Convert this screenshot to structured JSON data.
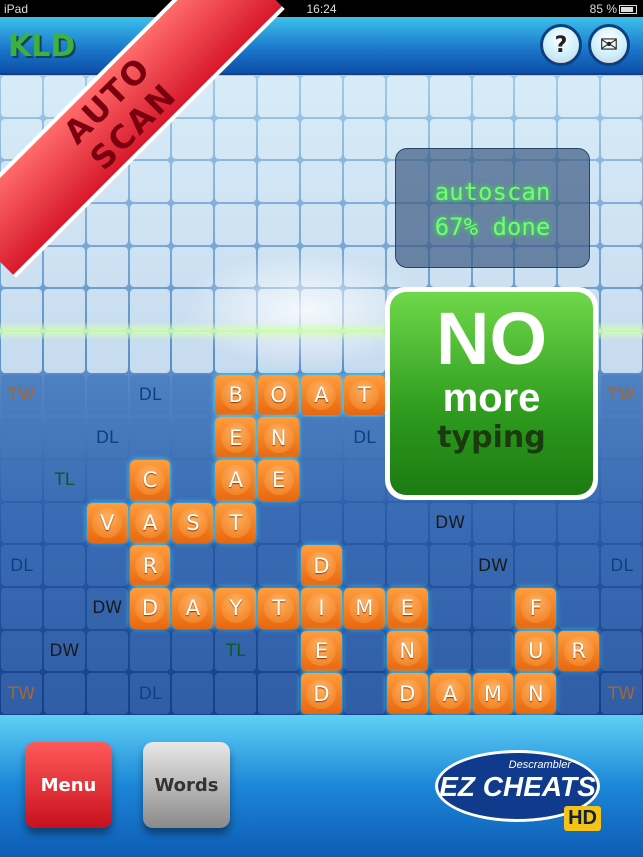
{
  "status_bar": {
    "device": "iPad",
    "time": "16:24",
    "battery": "85 %"
  },
  "header": {
    "logo": "KLD",
    "help_label": "?",
    "mail_icon": "envelope-icon"
  },
  "ribbon": {
    "line1": "AUTO",
    "line2": "SCAN"
  },
  "autoscan": {
    "line1": "autoscan",
    "line2": "67% done",
    "progress_percent": 67
  },
  "promo": {
    "line1": "NO",
    "line2": "more",
    "line3": "typing"
  },
  "board": {
    "size": 15,
    "visible_rows_start": 7,
    "rows": [
      [
        "TW",
        "",
        "",
        "DL",
        "",
        "B",
        "O",
        "A",
        "T",
        "",
        "",
        "",
        "",
        "",
        "TW"
      ],
      [
        "",
        "",
        "DL",
        "",
        "",
        "E",
        "N",
        "",
        "DL",
        "",
        "",
        "",
        "",
        "",
        ""
      ],
      [
        "",
        "TL",
        "",
        "C",
        "",
        "A",
        "E",
        "",
        "",
        "",
        "",
        "",
        "",
        "",
        ""
      ],
      [
        "",
        "",
        "V",
        "A",
        "S",
        "T",
        "",
        "",
        "",
        "",
        "DW",
        "",
        "",
        "",
        ""
      ],
      [
        "DL",
        "",
        "",
        "R",
        "",
        "",
        "",
        "D",
        "",
        "",
        "",
        "DW",
        "",
        "",
        "DL"
      ],
      [
        "",
        "",
        "DW",
        "D",
        "A",
        "Y",
        "T",
        "I",
        "M",
        "E",
        "",
        "",
        "F",
        "",
        ""
      ],
      [
        "",
        "DW",
        "",
        "",
        "",
        "TL",
        "",
        "E",
        "",
        "N",
        "",
        "",
        "U",
        "R",
        ""
      ],
      [
        "TW",
        "",
        "",
        "DL",
        "",
        "",
        "",
        "D",
        "",
        "D",
        "A",
        "M",
        "N",
        "",
        "TW"
      ]
    ]
  },
  "footer": {
    "menu_label": "Menu",
    "words_label": "Words",
    "brand_small": "Descrambler",
    "brand": "EZ CHEATS",
    "brand_badge": "HD"
  }
}
